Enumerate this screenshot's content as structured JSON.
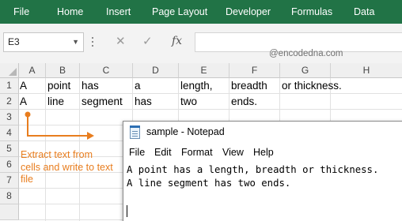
{
  "ribbon": {
    "color": "#217346",
    "tabs": [
      "File",
      "Home",
      "Insert",
      "Page Layout",
      "Developer",
      "Formulas",
      "Data"
    ]
  },
  "formula_bar": {
    "name_box": "E3",
    "cancel_icon": "close-icon",
    "enter_icon": "check-icon",
    "fx_label": "fx",
    "formula": ""
  },
  "watermark": "@encodedna.com",
  "sheet": {
    "columns": [
      "A",
      "B",
      "C",
      "D",
      "E",
      "F",
      "G",
      "H"
    ],
    "rows": [
      "1",
      "2",
      "3",
      "4",
      "5",
      "6",
      "7",
      "8"
    ],
    "cells": {
      "r1": [
        "A",
        "point",
        "has",
        "a",
        "length,",
        "breadth",
        "or thickness."
      ],
      "r2": [
        "A",
        "line",
        "segment",
        "has",
        "two",
        "ends."
      ]
    },
    "active_cell": "E3"
  },
  "annotation": {
    "color": "#e87d1e",
    "text": "Extract text from cells and write to text file"
  },
  "notepad": {
    "title": "sample - Notepad",
    "icon": "notepad-icon",
    "menu": [
      "File",
      "Edit",
      "Format",
      "View",
      "Help"
    ],
    "lines": [
      "A point has a length, breadth or thickness.",
      "A line segment has two ends."
    ]
  }
}
